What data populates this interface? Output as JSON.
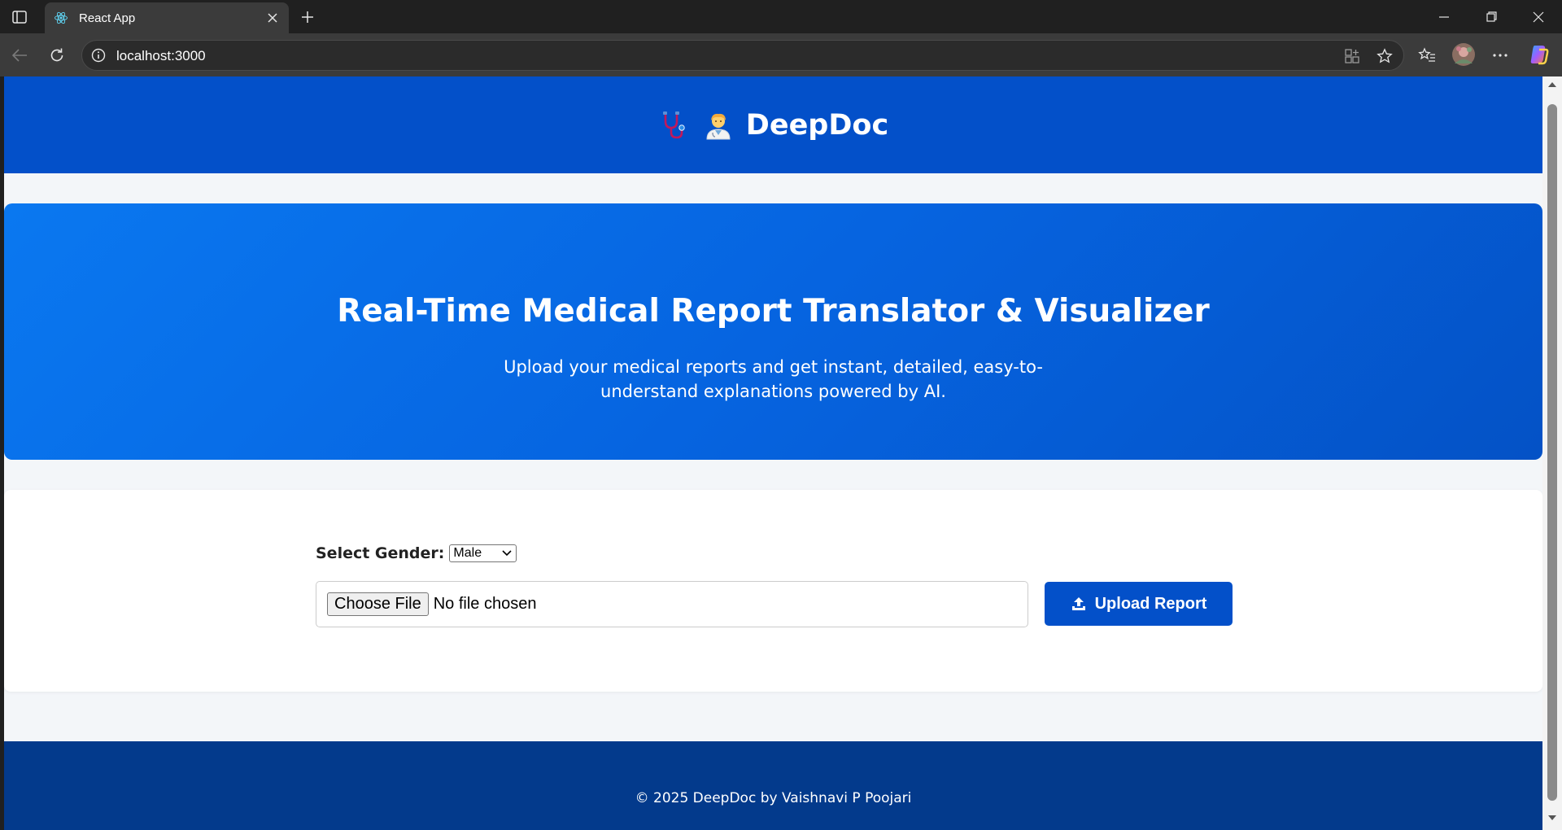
{
  "browser": {
    "tab_title": "React App",
    "url": "localhost:3000"
  },
  "header": {
    "brand": "DeepDoc",
    "icons": [
      "stethoscope-icon",
      "health-worker-icon"
    ]
  },
  "hero": {
    "title": "Real-Time Medical Report Translator & Visualizer",
    "subtitle": "Upload your medical reports and get instant, detailed, easy-to-understand explanations powered by AI."
  },
  "upload": {
    "gender_label": "Select Gender:",
    "gender_value": "Male",
    "choose_file_label": "Choose File",
    "file_status": "No file chosen",
    "upload_button_label": "Upload Report"
  },
  "footer": {
    "text": "© 2025 DeepDoc by Vaishnavi P Poojari"
  },
  "colors": {
    "header_bg": "#0350c9",
    "hero_gradient_start": "#0a78f0",
    "hero_gradient_end": "#0452c6",
    "footer_bg": "#033a8c",
    "button_bg": "#0350c9",
    "page_bg": "#f3f6f9"
  }
}
